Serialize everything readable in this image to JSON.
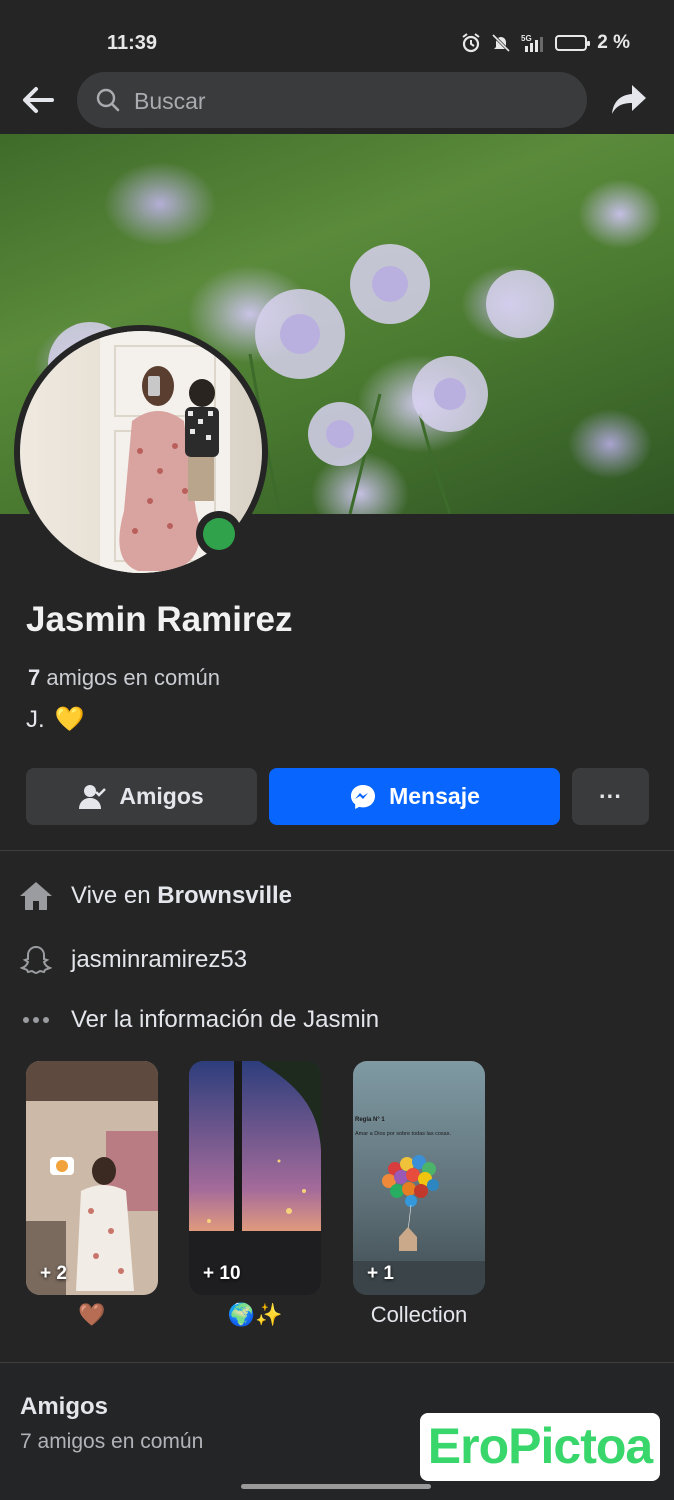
{
  "status_bar": {
    "time": "11:39",
    "network": "5G",
    "battery": "2 %"
  },
  "search": {
    "placeholder": "Buscar"
  },
  "profile": {
    "name": "Jasmin Ramirez",
    "mutual_count": "7",
    "mutual_text": "amigos en común",
    "bio": "J.",
    "bio_emoji": "💛"
  },
  "actions": {
    "friends_label": "Amigos",
    "message_label": "Mensaje",
    "more_label": "···"
  },
  "details": {
    "lives_prefix": "Vive en",
    "lives_city": "Brownsville",
    "snapchat": "jasminramirez53",
    "more_info": "Ver la información de Jasmin"
  },
  "highlights": [
    {
      "count": "+ 2",
      "label": "🤎"
    },
    {
      "count": "+ 10",
      "label": "🌍✨"
    },
    {
      "count": "+ 1",
      "label": "Collection",
      "caption_title": "Regla N° 1",
      "caption_text": "Amar a Dios por sobre todas las cosas."
    }
  ],
  "friends_section": {
    "title": "Amigos",
    "subtitle": "7 amigos en común"
  },
  "watermark": "EroPictoa",
  "colors": {
    "accent": "#0866ff",
    "online": "#31a24c",
    "background": "#252526"
  }
}
